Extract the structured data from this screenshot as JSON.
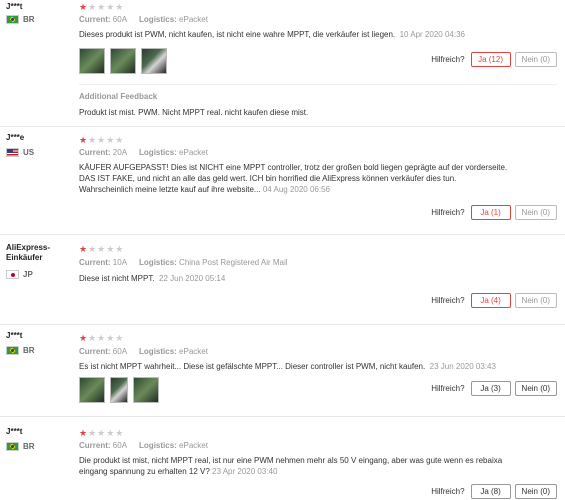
{
  "reviews": [
    {
      "user": "J***t",
      "country": "BR",
      "rating": "1",
      "current_label": "Current:",
      "current": "60A",
      "logistics_label": "Logistics:",
      "logistics": "ePacket",
      "text": "Dieses produkt ist PWM, nicht kaufen, ist nicht eine wahre MPPT, die verkäufer ist liegen.",
      "date": "10 Apr 2020 04:36",
      "thumbs": 3,
      "helpful_label": "Hilfreich?",
      "yes": "Ja (12)",
      "no": "Nein (0)",
      "additional_title": "Additional Feedback",
      "additional_text": "Produkt ist mist. PWM. Nicht MPPT real. nicht kaufen diese mist."
    },
    {
      "user": "J***e",
      "country": "US",
      "rating": "1",
      "current_label": "Current:",
      "current": "20A",
      "logistics_label": "Logistics:",
      "logistics": "ePacket",
      "text_lines": [
        "KÄUFER AUFGEPASST! Dies ist NICHT eine MPPT controller, trotz der großen bold liegen geprägte auf der vorderseite.",
        "DAS IST FAKE, und nicht an alle das geld wert. ICH bin horrified die AliExpress können verkäufer dies tun.",
        "Wahrscheinlich meine letzte kauf auf ihre website..."
      ],
      "date": "04 Aug 2020 06:56",
      "helpful_label": "Hilfreich?",
      "yes": "Ja (1)",
      "no": "Nein (0)"
    },
    {
      "user": "AliExpress-Einkäufer",
      "country": "JP",
      "rating": "1",
      "current_label": "Current:",
      "current": "10A",
      "logistics_label": "Logistics:",
      "logistics": "China Post Registered Air Mail",
      "text": "Diese ist nicht MPPT.",
      "date": "22 Jun 2020 05:14",
      "helpful_label": "Hilfreich?",
      "yes": "Ja (4)",
      "no": "Nein (0)"
    },
    {
      "user": "J***t",
      "country": "BR",
      "rating": "1",
      "current_label": "Current:",
      "current": "60A",
      "logistics_label": "Logistics:",
      "logistics": "ePacket",
      "text": "Es ist nicht MPPT wahrheit... Diese ist gefälschte MPPT... Dieser controller ist PWM, nicht kaufen.",
      "date": "23 Jun 2020 03:43",
      "thumbs": 3,
      "helpful_label": "Hilfreich?",
      "yes": "Ja (3)",
      "no": "Nein (0)"
    },
    {
      "user": "J***t",
      "country": "BR",
      "rating": "1",
      "current_label": "Current:",
      "current": "60A",
      "logistics_label": "Logistics:",
      "logistics": "ePacket",
      "text_lines": [
        "Die produkt ist mist, nicht MPPT real, ist nur eine PWM nehmen mehr als 50 V eingang, aber was gute wenn es rebaixa",
        "eingang spannung zu erhalten 12 V?"
      ],
      "date": "23 Apr 2020 03:40",
      "helpful_label": "Hilfreich?",
      "yes": "Ja (8)",
      "no": "Nein (0)"
    }
  ],
  "icons": {
    "star_filled": "★",
    "star_empty": "★"
  },
  "colors": {
    "accent": "#e64340",
    "muted": "#999999"
  }
}
